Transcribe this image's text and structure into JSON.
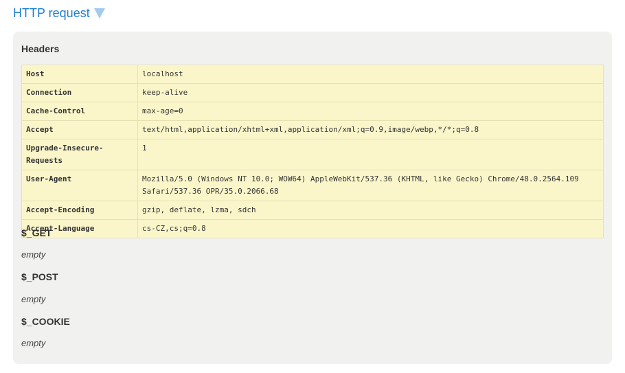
{
  "toggle": {
    "label": "HTTP request",
    "icon": "triangle-down-icon",
    "color": "#1e7fd0"
  },
  "headers_section": {
    "title": "Headers",
    "rows": [
      {
        "key": "Host",
        "value": "localhost"
      },
      {
        "key": "Connection",
        "value": "keep-alive"
      },
      {
        "key": "Cache-Control",
        "value": "max-age=0"
      },
      {
        "key": "Accept",
        "value": "text/html,application/xhtml+xml,application/xml;q=0.9,image/webp,*/*;q=0.8"
      },
      {
        "key": "Upgrade-Insecure-Requests",
        "value": "1"
      },
      {
        "key": "User-Agent",
        "value": "Mozilla/5.0 (Windows NT 10.0; WOW64) AppleWebKit/537.36 (KHTML, like Gecko) Chrome/48.0.2564.109 Safari/537.36 OPR/35.0.2066.68"
      },
      {
        "key": "Accept-Encoding",
        "value": "gzip, deflate, lzma, sdch"
      },
      {
        "key": "Accept-Language",
        "value": "cs-CZ,cs;q=0.8"
      }
    ]
  },
  "get_section": {
    "title": "$_GET",
    "value": "empty"
  },
  "post_section": {
    "title": "$_POST",
    "value": "empty"
  },
  "cookie_section": {
    "title": "$_COOKIE",
    "value": "empty"
  }
}
